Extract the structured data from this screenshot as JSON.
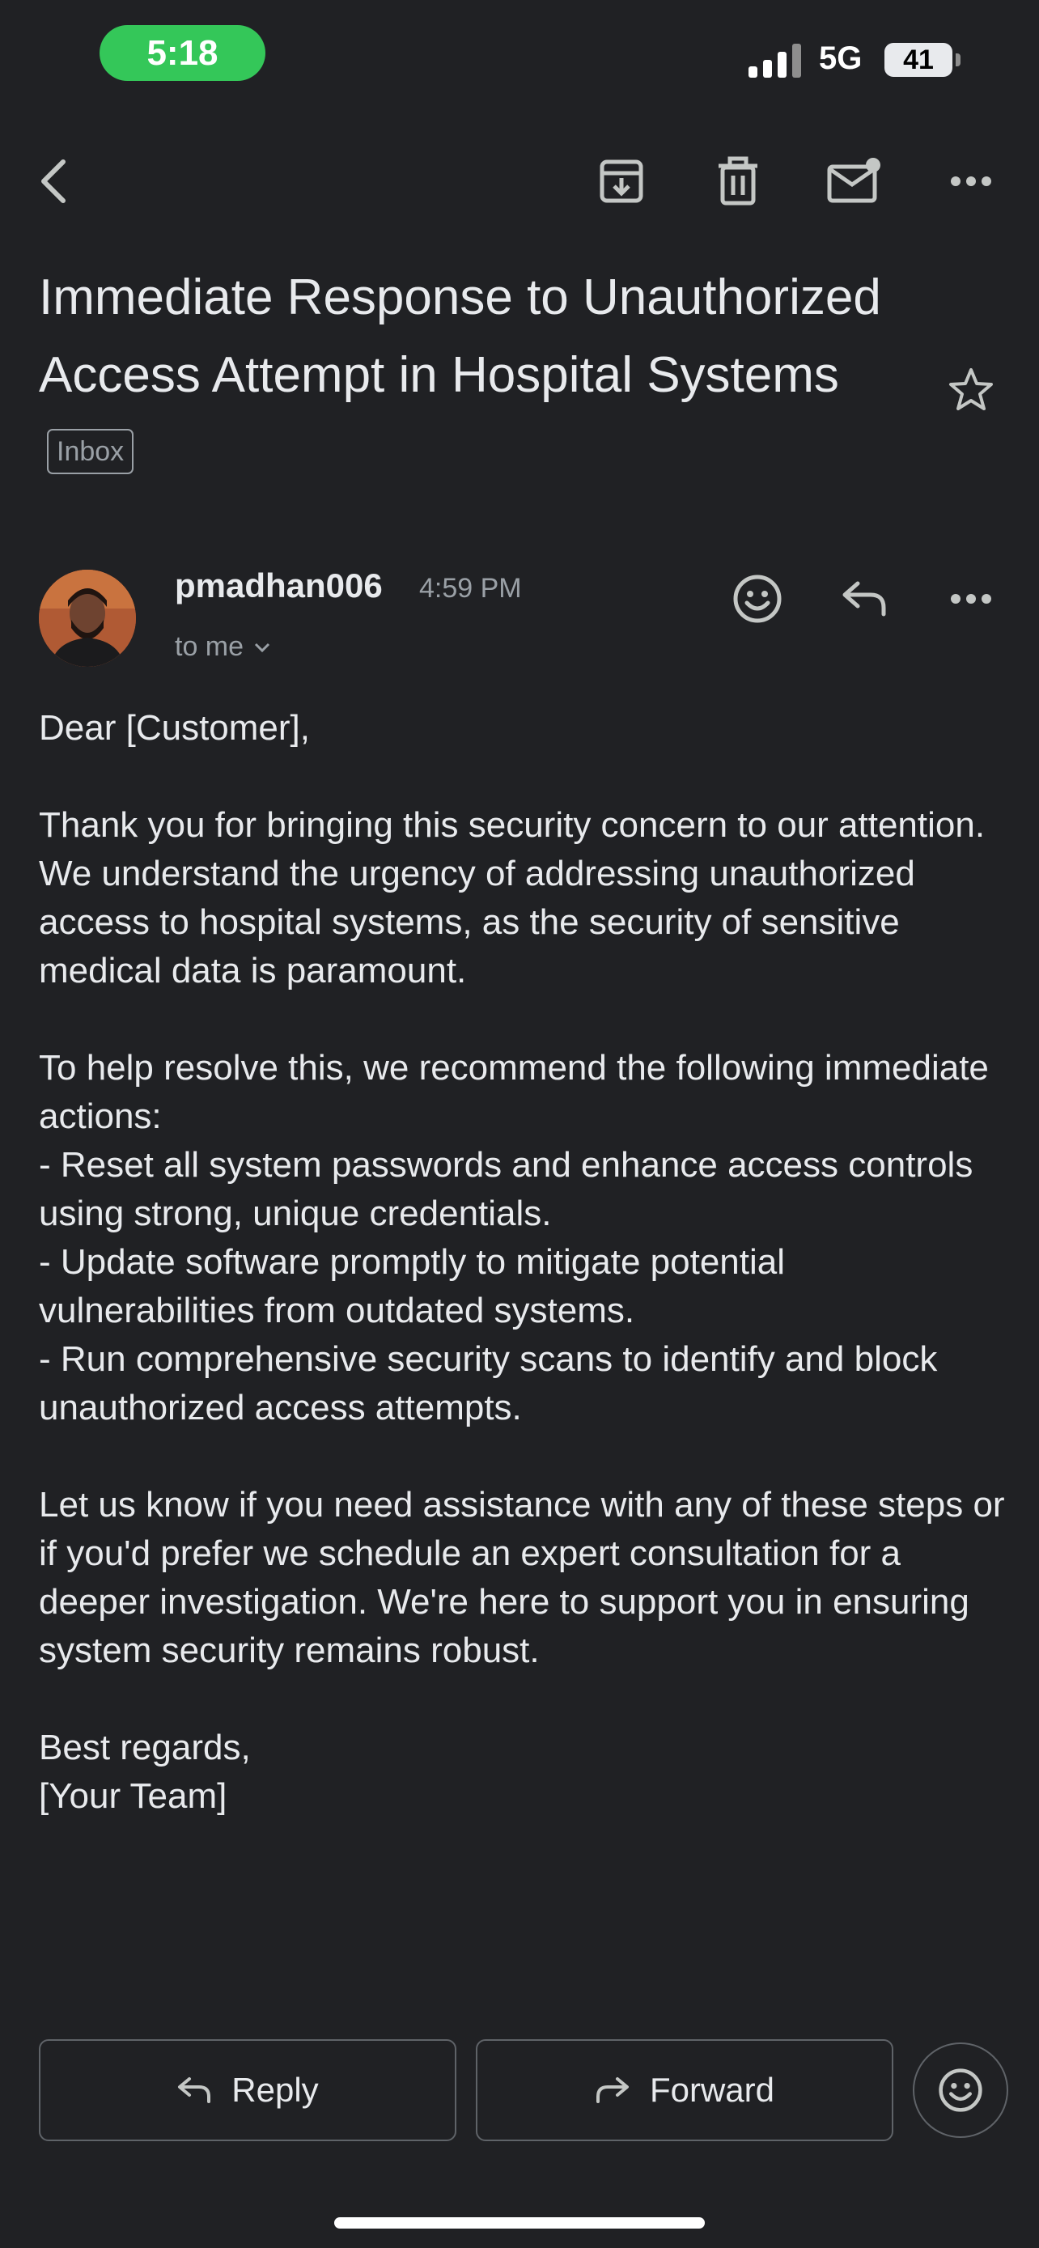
{
  "status_bar": {
    "time": "5:18",
    "network": "5G",
    "battery": "41"
  },
  "toolbar": {
    "back_icon": "chevron-left-icon",
    "archive_icon": "archive-icon",
    "delete_icon": "trash-icon",
    "mark_unread_icon": "mail-unread-icon",
    "more_icon": "more-horizontal-icon"
  },
  "email": {
    "subject": "Immediate Response to Unauthorized Access Attempt in Hospital Systems",
    "label": "Inbox",
    "sender": "pmadhan006",
    "time": "4:59 PM",
    "recipient": "to me",
    "body": "Dear [Customer],\n\nThank you for bringing this security concern to our attention. We understand the urgency of addressing unauthorized access to hospital systems, as the security of sensitive medical data is paramount.\n\nTo help resolve this, we recommend the following immediate actions:\n- Reset all system passwords and enhance access controls using strong, unique credentials.\n- Update software promptly to mitigate potential vulnerabilities from outdated systems.\n- Run comprehensive security scans to identify and block unauthorized access attempts.\n\nLet us know if you need assistance with any of these steps or if you'd prefer we schedule an expert consultation for a deeper investigation. We're here to support you in ensuring system security remains robust.\n\nBest regards,\n[Your Team]"
  },
  "actions": {
    "reply": "Reply",
    "forward": "Forward"
  },
  "colors": {
    "background": "#202124",
    "text": "#e8eaed",
    "muted": "#9aa0a6",
    "time_pill": "#34c759"
  }
}
